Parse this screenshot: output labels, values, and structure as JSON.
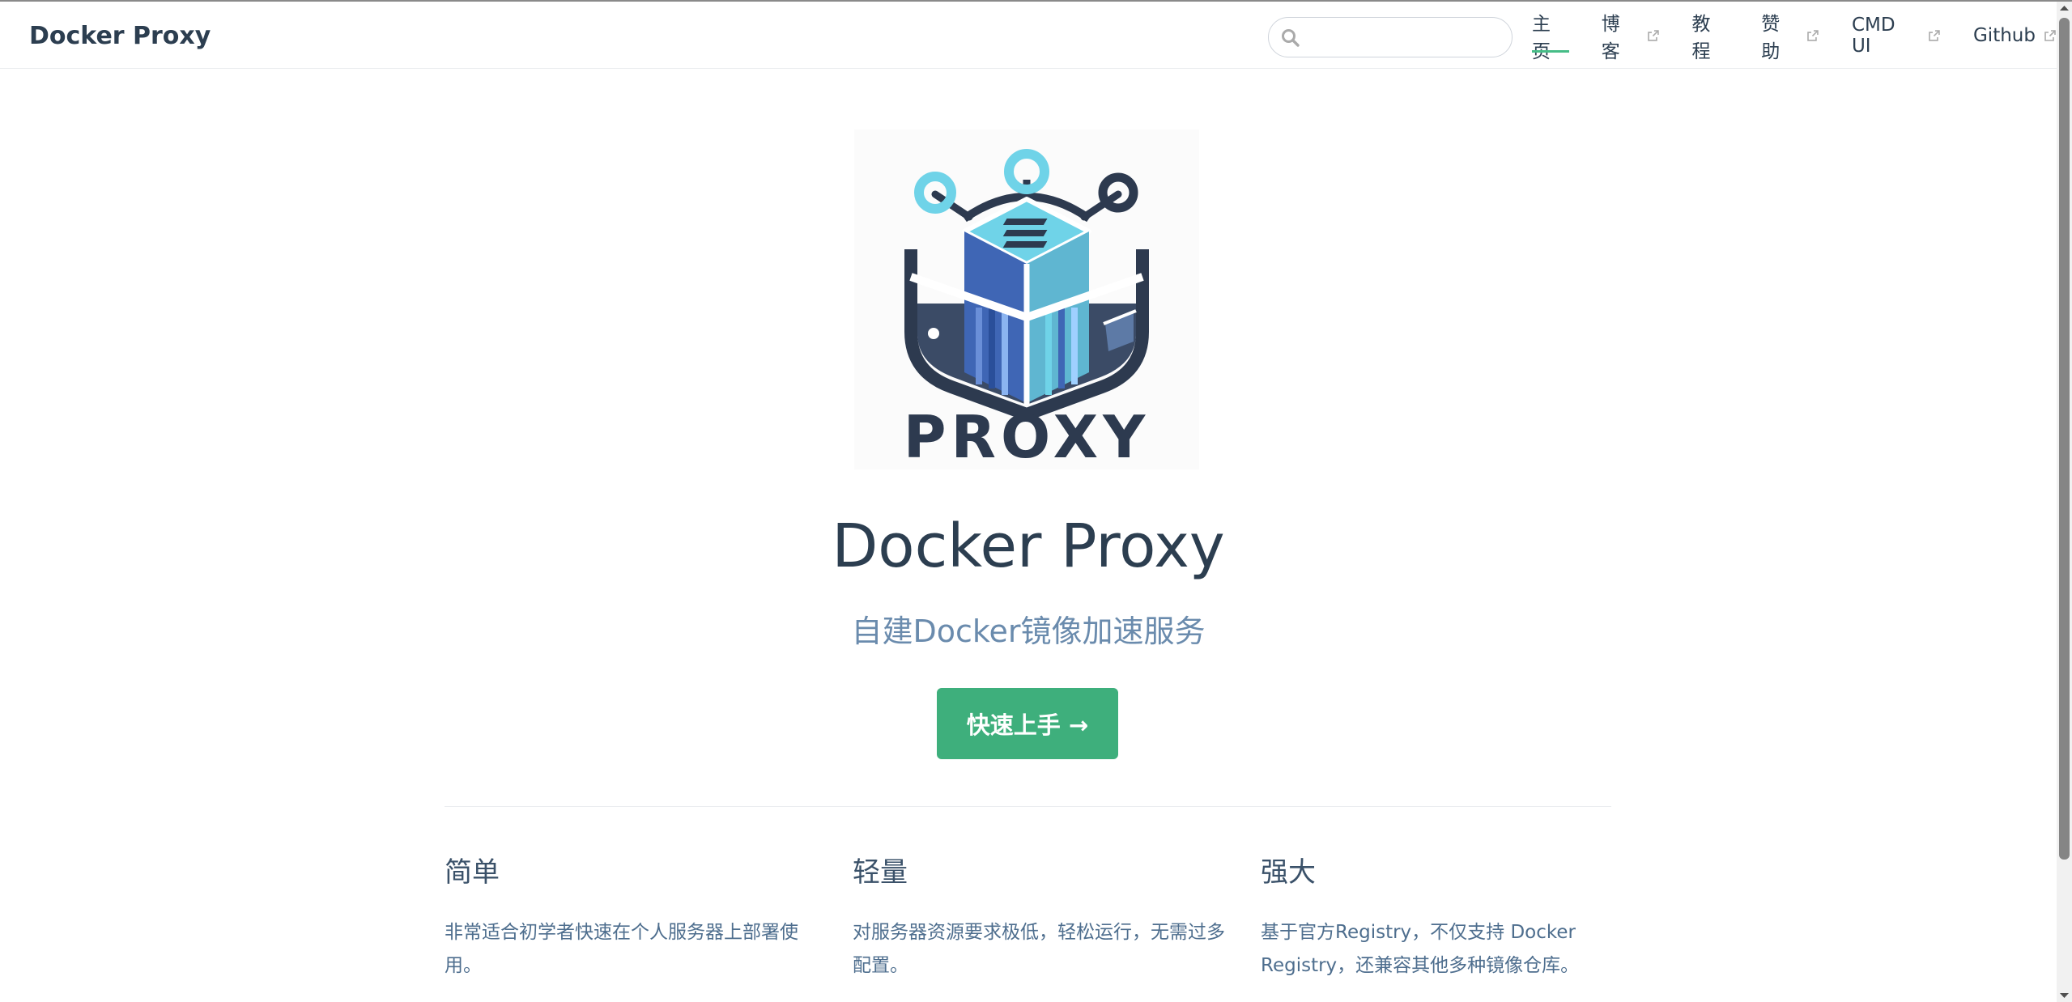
{
  "navbar": {
    "site_name": "Docker Proxy",
    "search": {
      "value": "",
      "placeholder": ""
    },
    "links": [
      {
        "label": "主页",
        "external": false,
        "active": true
      },
      {
        "label": "博客",
        "external": true,
        "active": false
      },
      {
        "label": "教程",
        "external": false,
        "active": false
      },
      {
        "label": "赞助",
        "external": true,
        "active": false
      },
      {
        "label": "CMD UI",
        "external": true,
        "active": false
      },
      {
        "label": "Github",
        "external": true,
        "active": false
      }
    ]
  },
  "hero": {
    "logo_text": "PROXY",
    "title": "Docker Proxy",
    "subtitle": "自建Docker镜像加速服务",
    "action_label": "快速上手 →"
  },
  "features": [
    {
      "title": "简单",
      "description": "非常适合初学者快速在个人服务器上部署使用。"
    },
    {
      "title": "轻量",
      "description": "对服务器资源要求极低，轻松运行，无需过多配置。"
    },
    {
      "title": "强大",
      "description": "基于官方Registry，不仅支持 Docker Registry，还兼容其他多种镜像仓库。"
    }
  ],
  "colors": {
    "accent": "#3eaf7c",
    "text": "#2c3e50",
    "subtitle": "#6a8bad",
    "border": "#eaecef",
    "logo_dark": "#2d3a4f",
    "logo_cyan": "#6fd3e8",
    "logo_blue": "#3f66b5"
  },
  "icons": {
    "search": "search-icon",
    "external": "external-link-icon",
    "logo": "proxy-logo"
  }
}
